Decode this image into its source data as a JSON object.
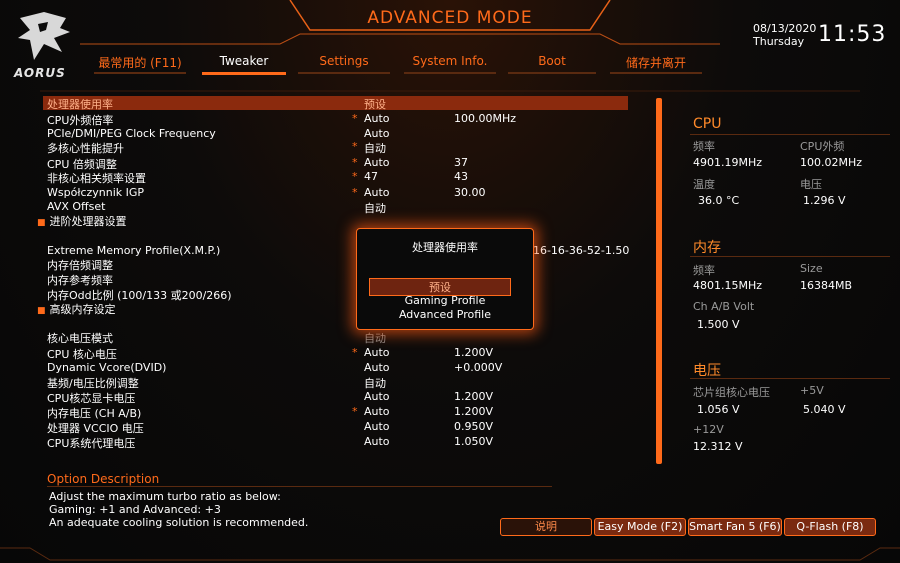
{
  "header": {
    "title": "ADVANCED MODE",
    "brand": "AORUS",
    "date": "08/13/2020",
    "weekday": "Thursday",
    "time": "11:53"
  },
  "tabs": [
    "最常用的 (F11)",
    "Tweaker",
    "Settings",
    "System Info.",
    "Boot",
    "储存并离开"
  ],
  "active_tab": "Tweaker",
  "settings": [
    {
      "label": "处理器使用率",
      "star": "",
      "value": "预设",
      "value2": ""
    },
    {
      "label": "CPU外频倍率",
      "star": "*",
      "value": "Auto",
      "value2": "100.00MHz"
    },
    {
      "label": "PCIe/DMI/PEG Clock Frequency",
      "star": "",
      "value": "Auto",
      "value2": ""
    },
    {
      "label": "多核心性能提升",
      "star": "*",
      "value": "自动",
      "value2": ""
    },
    {
      "label": "CPU 倍频调整",
      "star": "*",
      "value": "Auto",
      "value2": "37"
    },
    {
      "label": "非核心相关频率设置",
      "star": "*",
      "value": "47",
      "value2": "43"
    },
    {
      "label": "Współczynnik IGP",
      "star": "*",
      "value": "Auto",
      "value2": "30.00"
    },
    {
      "label": "AVX Offset",
      "star": "",
      "value": "自动",
      "value2": ""
    },
    {
      "label": "Extreme Memory Profile(X.M.P.)",
      "star": "",
      "value": "",
      "value2": "5-16-16-36-52-1.50"
    },
    {
      "label": "内存倍频调整",
      "star": "",
      "value": "",
      "value2": ""
    },
    {
      "label": "内存参考频率",
      "star": "",
      "value": "",
      "value2": ""
    },
    {
      "label": "内存Odd比例 (100/133 或200/266)",
      "star": "",
      "value": "",
      "value2": ""
    },
    {
      "label": "核心电压模式",
      "star": "",
      "value": "自动",
      "value2": ""
    },
    {
      "label": "CPU 核心电压",
      "star": "*",
      "value": "Auto",
      "value2": "1.200V"
    },
    {
      "label": "Dynamic Vcore(DVID)",
      "star": "",
      "value": "Auto",
      "value2": "+0.000V"
    },
    {
      "label": "基频/电压比例调整",
      "star": "",
      "value": "自动",
      "value2": ""
    },
    {
      "label": "CPU核芯显卡电压",
      "star": "",
      "value": "Auto",
      "value2": "1.200V"
    },
    {
      "label": "内存电压 (CH A/B)",
      "star": "*",
      "value": "Auto",
      "value2": "1.200V"
    },
    {
      "label": "处理器 VCCIO 电压",
      "star": "",
      "value": "Auto",
      "value2": "0.950V"
    },
    {
      "label": "CPU系统代理电压",
      "star": "",
      "value": "Auto",
      "value2": "1.050V"
    }
  ],
  "submenus": [
    "进阶处理器设置",
    "高级内存设定"
  ],
  "popup": {
    "title": "处理器使用率",
    "options": [
      "预设",
      "Gaming Profile",
      "Advanced Profile"
    ]
  },
  "panel": {
    "cpu": {
      "title": "CPU",
      "freq_label": "频率",
      "freq": "4901.19MHz",
      "bclk_label": "CPU外频",
      "bclk": "100.02MHz",
      "temp_label": "温度",
      "temp": "36.0 °C",
      "volt_label": "电压",
      "volt": "1.296 V"
    },
    "memory": {
      "title": "内存",
      "freq_label": "频率",
      "freq": "4801.15MHz",
      "size_label": "Size",
      "size": "16384MB",
      "volt_label": "Ch A/B Volt",
      "volt": "1.500 V"
    },
    "voltage": {
      "title": "电压",
      "pch_label": "芯片组核心电压",
      "pch": "1.056 V",
      "v5_label": "+5V",
      "v5": "5.040 V",
      "v12_label": "+12V",
      "v12": "12.312 V"
    }
  },
  "option_description": {
    "title": "Option Description",
    "lines": [
      "Adjust the maximum turbo ratio as below:",
      "Gaming: +1 and Advanced: +3",
      "An adequate cooling solution is recommended."
    ]
  },
  "buttons": {
    "help": "说明",
    "easy_mode": "Easy Mode (F2)",
    "smart_fan": "Smart Fan 5 (F6)",
    "qflash": "Q-Flash (F8)"
  },
  "colors": {
    "accent": "#ff6a1a",
    "selected_row": "#8b2a0d"
  }
}
